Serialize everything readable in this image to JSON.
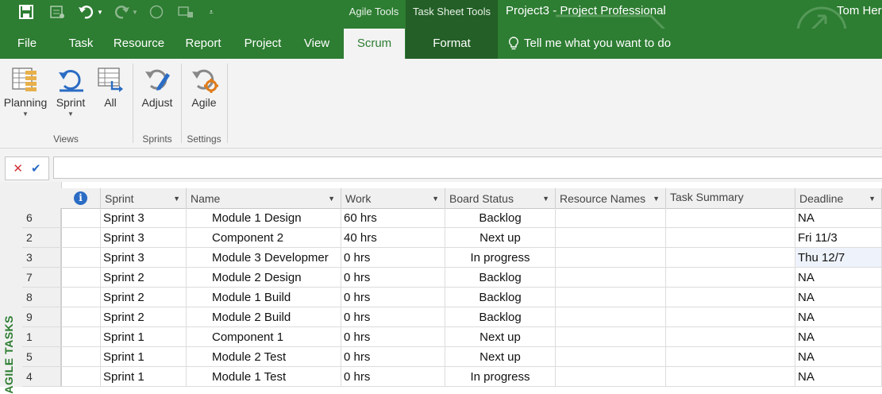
{
  "colors": {
    "brand": "#2d7d32",
    "brand_dark": "#235f26",
    "ribbon_bg": "#f3f3f3",
    "info_blue": "#2b6cc4",
    "cancel_red": "#d13438"
  },
  "titlebar": {
    "context_agile": "Agile Tools",
    "context_task_sheet": "Task Sheet Tools",
    "title": "Project3  -  Project Professional",
    "user": "Tom Her",
    "qat_icons": [
      "save-icon",
      "new-project-icon",
      "undo-icon",
      "redo-icon",
      "circle-icon",
      "view-icon",
      "customize-qat-icon"
    ]
  },
  "tabs": [
    {
      "label": "File"
    },
    {
      "label": "Task"
    },
    {
      "label": "Resource"
    },
    {
      "label": "Report"
    },
    {
      "label": "Project"
    },
    {
      "label": "View"
    },
    {
      "label": "Scrum"
    },
    {
      "label": "Format"
    }
  ],
  "tell_me": "Tell me what you want to do",
  "ribbon": {
    "buttons": {
      "planning": "Planning",
      "sprint": "Sprint",
      "all": "All",
      "adjust": "Adjust",
      "agile": "Agile"
    },
    "groups": {
      "views": "Views",
      "sprints": "Sprints",
      "settings": "Settings"
    }
  },
  "side_label": "AGILE TASKS",
  "columns": {
    "sprint": "Sprint",
    "name": "Name",
    "work": "Work",
    "board_status": "Board Status",
    "resource_names": "Resource Names",
    "task_summary": "Task Summary",
    "deadline": "Deadline"
  },
  "rows": [
    {
      "id": "6",
      "sprint": "Sprint 3",
      "name": "Module 1 Design",
      "work": "60 hrs",
      "status": "Backlog",
      "resources": "",
      "summary": "",
      "deadline": "NA"
    },
    {
      "id": "2",
      "sprint": "Sprint 3",
      "name": "Component 2",
      "work": "40 hrs",
      "status": "Next up",
      "resources": "",
      "summary": "",
      "deadline": "Fri 11/3"
    },
    {
      "id": "3",
      "sprint": "Sprint 3",
      "name": "Module 3 Developmer",
      "work": "0 hrs",
      "status": "In progress",
      "resources": "",
      "summary": "",
      "deadline": "Thu 12/7"
    },
    {
      "id": "7",
      "sprint": "Sprint 2",
      "name": "Module 2 Design",
      "work": "0 hrs",
      "status": "Backlog",
      "resources": "",
      "summary": "",
      "deadline": "NA"
    },
    {
      "id": "8",
      "sprint": "Sprint 2",
      "name": "Module 1 Build",
      "work": "0 hrs",
      "status": "Backlog",
      "resources": "",
      "summary": "",
      "deadline": "NA"
    },
    {
      "id": "9",
      "sprint": "Sprint 2",
      "name": "Module 2 Build",
      "work": "0 hrs",
      "status": "Backlog",
      "resources": "",
      "summary": "",
      "deadline": "NA"
    },
    {
      "id": "1",
      "sprint": "Sprint 1",
      "name": "Component 1",
      "work": "0 hrs",
      "status": "Next up",
      "resources": "",
      "summary": "",
      "deadline": "NA"
    },
    {
      "id": "5",
      "sprint": "Sprint 1",
      "name": "Module 2 Test",
      "work": "0 hrs",
      "status": "Next up",
      "resources": "",
      "summary": "",
      "deadline": "NA"
    },
    {
      "id": "4",
      "sprint": "Sprint 1",
      "name": "Module 1 Test",
      "work": "0 hrs",
      "status": "In progress",
      "resources": "",
      "summary": "",
      "deadline": "NA"
    }
  ]
}
